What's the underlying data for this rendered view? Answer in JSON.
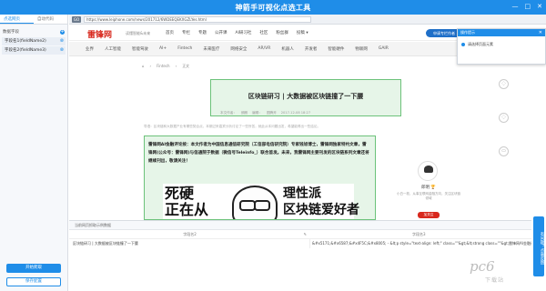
{
  "app": {
    "title": "神箭手可视化点选工具",
    "window_controls": [
      "—",
      "□",
      "✕"
    ]
  },
  "left_panel": {
    "tabs": [
      "点选网页",
      "自动代码"
    ],
    "header_label": "数据字段",
    "fields": [
      "字段名1(fieldName2)",
      "字段名2(fieldName3)"
    ],
    "start_button": "开始爬取",
    "export_button": "保存配置"
  },
  "url_bar": {
    "go_label": "GO",
    "url": "https://www.leiphone.com/news/201712/6WDEEQEKXGZLYes.html"
  },
  "site": {
    "logo": "雷锋网",
    "logo_sub": "读懂智能&未来",
    "top_nav": [
      "首页",
      "专栏",
      "专题",
      "公开课",
      "AI研习社",
      "社区",
      "粉丝群",
      "投稿 ▾"
    ],
    "login_button": "申请专栏作者",
    "cat_nav": [
      "业界",
      "人工智能",
      "智能驾驶",
      "AI+",
      "Fintech",
      "未来医疗",
      "网络安全",
      "AR/VR",
      "机器人",
      "开发者",
      "智能硬件",
      "物联网",
      "GAIR"
    ],
    "breadcrumb": [
      "⌂",
      "›",
      "Fintech",
      "›",
      "正文"
    ]
  },
  "article": {
    "title": "区块链研习 | 大数据被区块链撞了一下腰",
    "meta": [
      "本文作者：",
      "朗朗",
      "编辑：",
      "图腾斧",
      "2017-12-08 18:27"
    ],
    "summary": "导语：区块链和大数据产业有哪些契合点，本期过来嘉宾分析讨论了一些所答，就此从本问题出发，希望能得出一些结论。",
    "content": "雷锋网AI金融评论按：本文作者为中国信息通信研究院（工信部电信研究院）专家钱旭博士，雷锋网独家特约文章，雷锋网(公众号：雷锋网)与信通院于数据（微信号Teleinfo_）联合首发。未来，我雷锋网主要刊发的区块链系列文章还将继续刊出，敬请关注！",
    "image_text_left": "死硬\n正在从",
    "image_text_right": "理性派\n区块链爱好者"
  },
  "author": {
    "name": "郎明 🏆",
    "desc": "小白一枚，从事互联网金融方向，关注区块链领域",
    "follow_button": "加关注"
  },
  "popup": {
    "title": "操作提示",
    "close": "✕",
    "message": "请选择页面元素"
  },
  "results": {
    "bar_label": "当前网页抓取示例数据",
    "columns": [
      "字段名2",
      "字段名3"
    ],
    "edit_icon_label": "✎",
    "rows": [
      [
        "区块链研习 | 大数据被区块链撞了一下腰",
        "&#x5171;&#x6587;&#x4F5C;&#x8005; - &lt;p style=\"text-align: left;\" class=\"\"&gt;&lt;strong class=\"\"&gt;雷锋网AI金融评论按：本文作者为中国信息..."
      ]
    ]
  },
  "side_tab": "有问题？点我反馈",
  "watermark": {
    "main": "pc6",
    "sub": "下载站"
  },
  "colors": {
    "accent": "#1f8de8",
    "selection_green": "#6cc27a",
    "brand_red": "#d8281d"
  }
}
